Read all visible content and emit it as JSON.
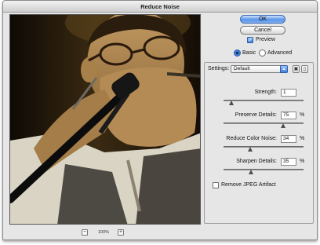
{
  "window": {
    "title": "Reduce Noise"
  },
  "preview": {
    "zoom_out": "−",
    "zoom_level": "100%",
    "zoom_in": "+"
  },
  "buttons": {
    "ok": "OK",
    "cancel": "Cancel"
  },
  "options": {
    "preview_label": "Preview",
    "preview_checked": true,
    "mode_basic": "Basic",
    "mode_advanced": "Advanced",
    "selected_mode": "Basic"
  },
  "settings": {
    "label": "Settings:",
    "value": "Default",
    "save_icon": "save-settings-icon",
    "delete_icon": "trash-icon"
  },
  "sliders": [
    {
      "label": "Strength:",
      "value": "1",
      "unit": "",
      "fraction": 0.1
    },
    {
      "label": "Preserve Details:",
      "value": "75",
      "unit": "%",
      "fraction": 0.75
    },
    {
      "label": "Reduce Color Noise:",
      "value": "34",
      "unit": "%",
      "fraction": 0.34
    },
    {
      "label": "Sharpen Details:",
      "value": "35",
      "unit": "%",
      "fraction": 0.35
    }
  ],
  "artifact": {
    "label": "Remove JPEG Artifact",
    "checked": false
  },
  "colors": {
    "accent": "#3f7ede",
    "window_bg": "#e6e6e6"
  }
}
